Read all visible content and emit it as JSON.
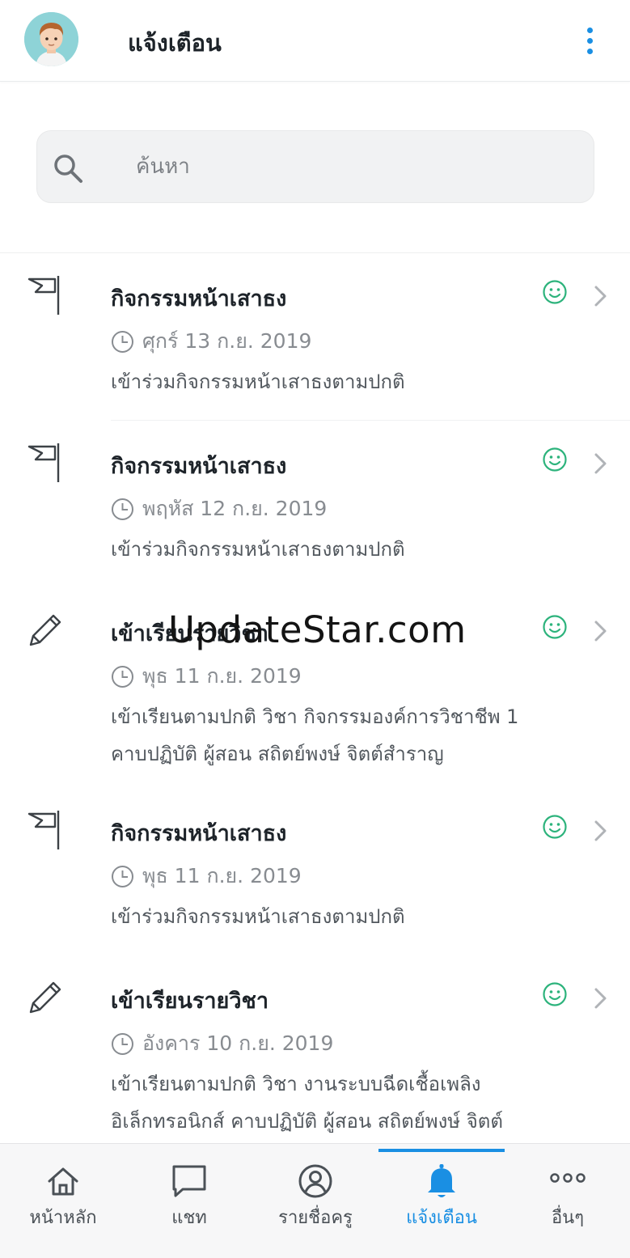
{
  "header": {
    "title": "แจ้งเตือน",
    "avatar_icon": "user-avatar",
    "menu_icon": "more-vertical-icon"
  },
  "search": {
    "placeholder": "ค้นหา",
    "icon": "search-icon"
  },
  "notifications": [
    {
      "type_icon": "flag-icon",
      "title": "กิจกรรมหน้าเสาธง",
      "date": "ศุกร์ 13 ก.ย. 2019",
      "description": "เข้าร่วมกิจกรรมหน้าเสาธงตามปกติ",
      "status_icon": "smile-icon"
    },
    {
      "type_icon": "flag-icon",
      "title": "กิจกรรมหน้าเสาธง",
      "date": "พฤหัส 12 ก.ย. 2019",
      "description": "เข้าร่วมกิจกรรมหน้าเสาธงตามปกติ",
      "status_icon": "smile-icon"
    },
    {
      "type_icon": "pencil-icon",
      "title": "เข้าเรียนรายวิชา",
      "date": "พุธ 11 ก.ย. 2019",
      "description_lines": [
        "เข้าเรียนตามปกติ วิชา กิจกรรมองค์การวิชาชีพ 1",
        "คาบปฏิบัติ ผู้สอน สถิตย์พงษ์ จิตต์สำราญ"
      ],
      "status_icon": "smile-icon"
    },
    {
      "type_icon": "flag-icon",
      "title": "กิจกรรมหน้าเสาธง",
      "date": "พุธ 11 ก.ย. 2019",
      "description": "เข้าร่วมกิจกรรมหน้าเสาธงตามปกติ",
      "status_icon": "smile-icon"
    },
    {
      "type_icon": "pencil-icon",
      "title": "เข้าเรียนรายวิชา",
      "date": "อังคาร 10 ก.ย. 2019",
      "description_lines": [
        "เข้าเรียนตามปกติ วิชา งานระบบฉีดเชื้อเพลิง",
        "อิเล็กทรอนิกส์ คาบปฏิบัติ ผู้สอน สถิตย์พงษ์ จิตต์"
      ],
      "status_icon": "smile-icon"
    }
  ],
  "watermark": "UpdateStar.com",
  "bottom_nav": [
    {
      "label": "หน้าหลัก",
      "icon": "home-icon",
      "active": false
    },
    {
      "label": "แชท",
      "icon": "chat-icon",
      "active": false
    },
    {
      "label": "รายชื่อครู",
      "icon": "user-circle-icon",
      "active": false
    },
    {
      "label": "แจ้งเตือน",
      "icon": "bell-icon",
      "active": true
    },
    {
      "label": "อื่นๆ",
      "icon": "more-horizontal-icon",
      "active": false
    }
  ],
  "colors": {
    "accent": "#1a8fe3",
    "smile": "#2db37c",
    "text": "#1d2329",
    "muted": "#888c91"
  }
}
